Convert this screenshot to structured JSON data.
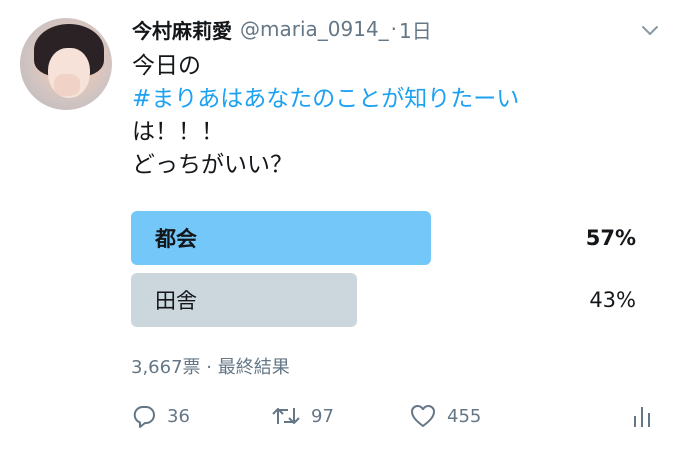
{
  "tweet": {
    "display_name": "今村麻莉愛",
    "handle": "@maria_0914_",
    "separator": "·",
    "time": "1日",
    "text_lines": [
      "今日の",
      "#まりあはあなたのことが知りたーい",
      "は！！！",
      "どっちがいい？"
    ]
  },
  "poll": {
    "options": [
      {
        "label": "都会",
        "percent": "57%",
        "value": 57,
        "winner": true
      },
      {
        "label": "田舎",
        "percent": "43%",
        "value": 43,
        "winner": false
      }
    ],
    "meta": "3,667票 · 最終結果"
  },
  "actions": {
    "reply_count": "36",
    "retweet_count": "97",
    "like_count": "455"
  },
  "icons": {
    "reply": "reply-icon",
    "retweet": "retweet-icon",
    "like": "heart-icon",
    "stats": "analytics-icon",
    "more": "chevron-down-icon"
  },
  "colors": {
    "accent": "#1da1f2",
    "poll_winner": "#73c8f9",
    "poll_other": "#ccd6dd",
    "muted": "#657786"
  }
}
